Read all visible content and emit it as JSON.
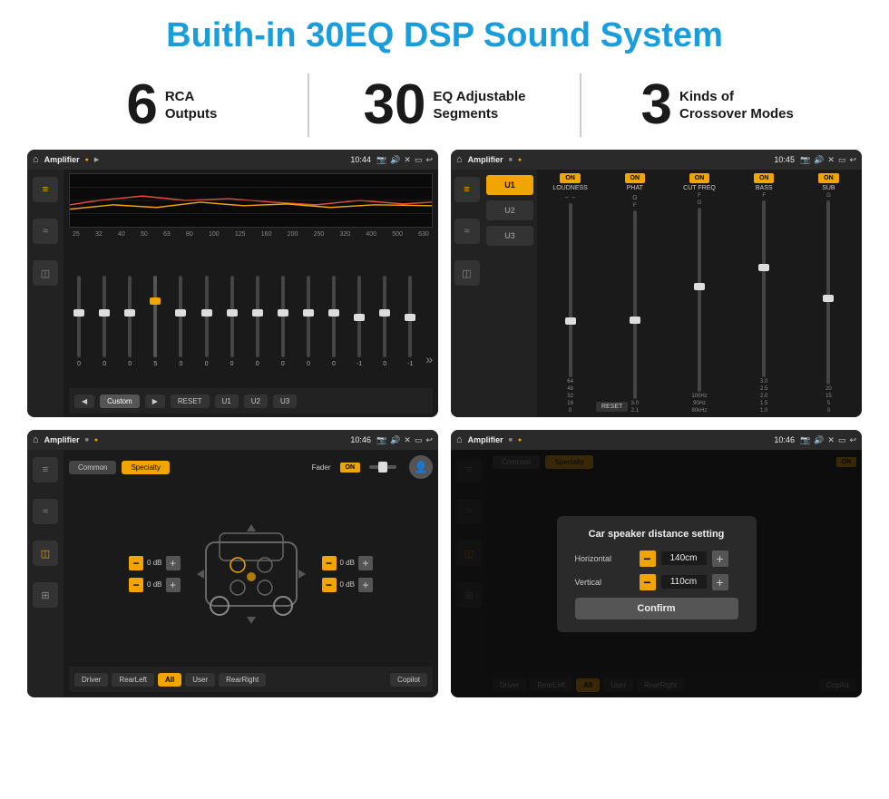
{
  "page": {
    "title": "Buith-in 30EQ DSP Sound System",
    "stats": [
      {
        "number": "6",
        "label": "RCA\nOutputs"
      },
      {
        "number": "30",
        "label": "EQ Adjustable\nSegments"
      },
      {
        "number": "3",
        "label": "Kinds of\nCrossover Modes"
      }
    ],
    "screens": [
      {
        "id": "screen1",
        "topbar": {
          "title": "Amplifier",
          "time": "10:44"
        },
        "eq_frequencies": [
          "25",
          "32",
          "40",
          "50",
          "63",
          "80",
          "100",
          "125",
          "160",
          "200",
          "250",
          "320",
          "400",
          "500",
          "630"
        ],
        "eq_values": [
          "0",
          "0",
          "0",
          "5",
          "0",
          "0",
          "0",
          "0",
          "0",
          "0",
          "0",
          "-1",
          "0",
          "-1"
        ],
        "bottom_buttons": [
          "◀",
          "Custom",
          "▶",
          "RESET",
          "U1",
          "U2",
          "U3"
        ]
      },
      {
        "id": "screen2",
        "topbar": {
          "title": "Amplifier",
          "time": "10:45"
        },
        "u_buttons": [
          "U1",
          "U2",
          "U3"
        ],
        "channels": [
          "LOUDNESS",
          "PHAT",
          "CUT FREQ",
          "BASS",
          "SUB"
        ],
        "channel_states": [
          "ON",
          "ON",
          "ON",
          "ON",
          "ON"
        ],
        "reset_label": "RESET"
      },
      {
        "id": "screen3",
        "topbar": {
          "title": "Amplifier",
          "time": "10:46"
        },
        "tabs": [
          "Common",
          "Specialty"
        ],
        "fader_label": "Fader",
        "fader_on": "ON",
        "db_values": [
          "0 dB",
          "0 dB",
          "0 dB",
          "0 dB"
        ],
        "bottom_buttons": [
          "Driver",
          "RearLeft",
          "All",
          "User",
          "RearRight",
          "Copilot"
        ]
      },
      {
        "id": "screen4",
        "topbar": {
          "title": "Amplifier",
          "time": "10:46"
        },
        "tabs": [
          "Common",
          "Specialty"
        ],
        "dialog": {
          "title": "Car speaker distance setting",
          "rows": [
            {
              "label": "Horizontal",
              "value": "140cm"
            },
            {
              "label": "Vertical",
              "value": "110cm"
            }
          ],
          "confirm_label": "Confirm"
        },
        "bottom_buttons": [
          "Driver",
          "RearLeft",
          "All",
          "User",
          "RearRight",
          "Copilot"
        ]
      }
    ]
  }
}
